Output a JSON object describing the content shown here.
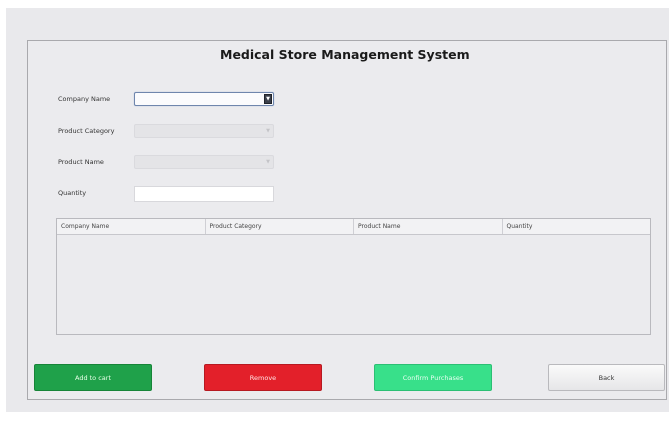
{
  "window": {
    "title": "Medical Store Management System"
  },
  "form": {
    "company_name_label": "Company Name",
    "product_category_label": "Product Category",
    "product_name_label": "Product Name",
    "quantity_label": "Quantity",
    "company_name_value": "",
    "product_category_value": "",
    "product_name_value": "",
    "quantity_value": ""
  },
  "table": {
    "columns": [
      "Company Name",
      "Product Category",
      "Product Name",
      "Quantity"
    ],
    "rows": []
  },
  "buttons": {
    "add_to_cart": "Add to cart",
    "remove": "Remove",
    "confirm_purchases": "Confirm Purchases",
    "back": "Back"
  },
  "colors": {
    "add_to_cart": "#1fa14a",
    "remove": "#e3202a",
    "confirm_purchases": "#38e08a",
    "back": "#f0f0f2"
  }
}
